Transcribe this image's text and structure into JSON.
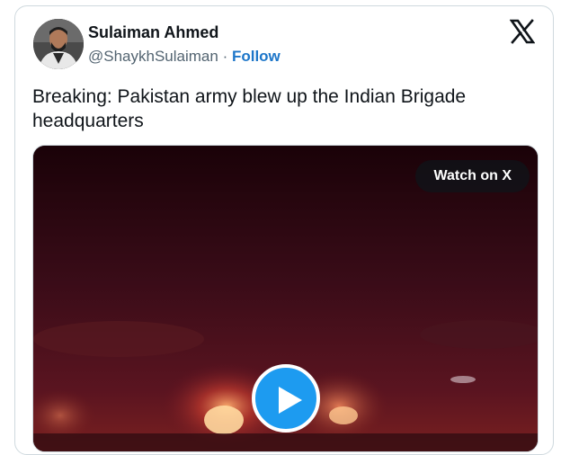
{
  "tweet": {
    "author_name": "Sulaiman Ahmed",
    "author_handle": "@ShaykhSulaiman",
    "separator": " · ",
    "follow_label": "Follow",
    "text": "Breaking: Pakistan army blew up the Indian Brigade headquarters"
  },
  "media": {
    "watch_label": "Watch on X",
    "play_icon": "play-icon"
  },
  "icons": {
    "brand": "x-logo-icon",
    "avatar": "avatar"
  },
  "colors": {
    "follow": "#1d76c9",
    "play": "#1d9bf0",
    "video_bg": "#2a0a12"
  }
}
